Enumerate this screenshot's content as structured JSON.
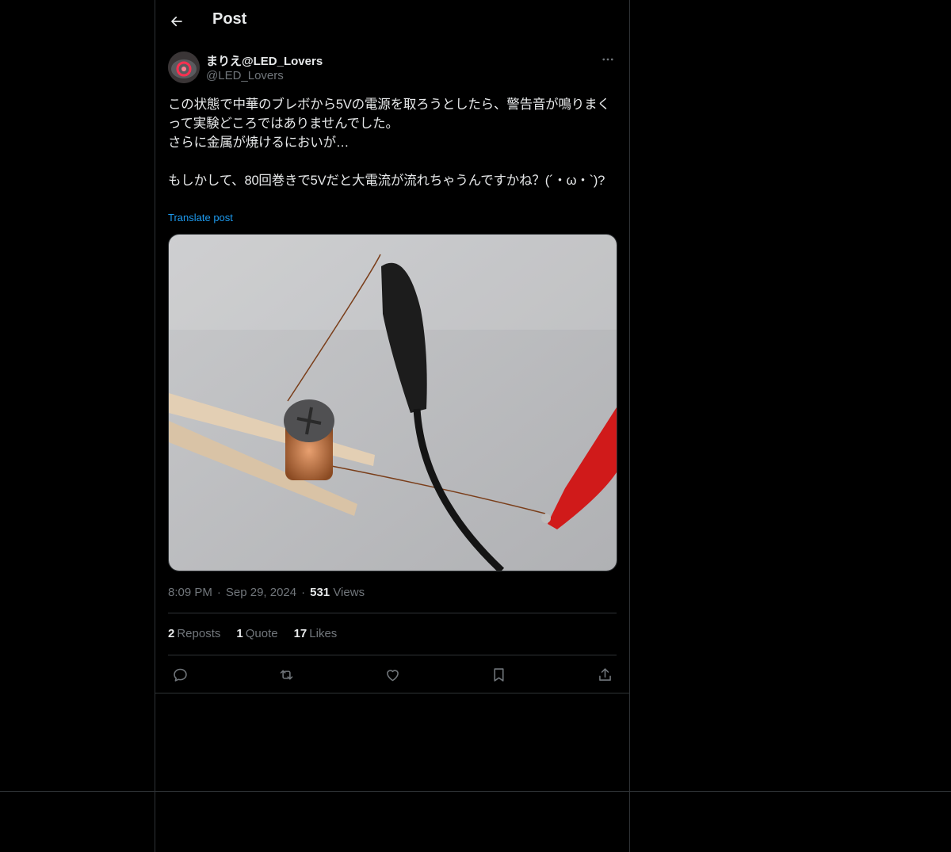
{
  "header": {
    "title": "Post"
  },
  "author": {
    "display_name": "まりえ@LED_Lovers",
    "handle": "@LED_Lovers"
  },
  "post": {
    "text": "この状態で中華のブレボから5Vの電源を取ろうとしたら、警告音が鳴りまくって実験どころではありませんでした。\nさらに金属が焼けるにおいが…\n\nもしかして、80回巻きで5Vだと大電流が流れちゃうんですかね？(´・ω・`)?",
    "translate_label": "Translate post",
    "time": "8:09 PM",
    "date": "Sep 29, 2024",
    "views_count": "531",
    "views_label": "Views"
  },
  "stats": {
    "reposts_count": "2",
    "reposts_label": "Reposts",
    "quotes_count": "1",
    "quotes_label": "Quote",
    "likes_count": "17",
    "likes_label": "Likes"
  },
  "colors": {
    "background": "#000000",
    "text": "#e7e9ea",
    "muted": "#71767b",
    "accent": "#1d9bf0",
    "border": "#2f3336"
  },
  "icons": [
    "back-arrow-icon",
    "more-icon",
    "reply-icon",
    "repost-icon",
    "like-icon",
    "bookmark-icon",
    "share-icon"
  ]
}
